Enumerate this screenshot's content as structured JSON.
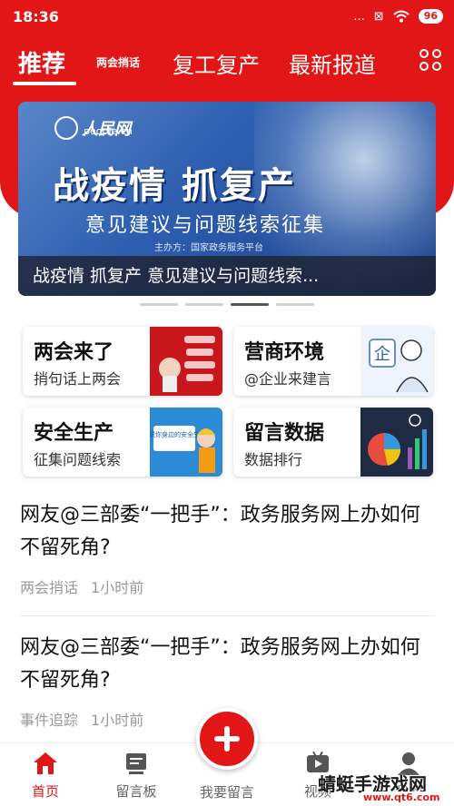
{
  "status": {
    "time": "18:36",
    "signal": "...",
    "battery": "96"
  },
  "tabs": [
    {
      "label": "推荐",
      "active": true
    },
    {
      "label": "两会捎话",
      "active": false
    },
    {
      "label": "复工复产",
      "active": false
    },
    {
      "label": "最新报道",
      "active": false
    }
  ],
  "banner": {
    "logo_text": "人民网",
    "logo_sub": "people.cn",
    "headline": "战疫情 抓复产",
    "sub": "意见建议与问题线索征集",
    "host": "主办方：国家政务服务平台",
    "caption": "战疫情 抓复产 意见建议与问题线索...",
    "page_count": 4,
    "active_page": 3
  },
  "cards": [
    {
      "title": "两会来了",
      "desc": "捎句话上两会",
      "icon": "two-sessions-thumb"
    },
    {
      "title": "营商环境",
      "desc": "@企业来建言",
      "icon": "business-thumb"
    },
    {
      "title": "安全生产",
      "desc": "征集问题线索",
      "icon": "safety-thumb",
      "thumb_text": "说说你身边的安全生产"
    },
    {
      "title": "留言数据",
      "desc": "数据排行",
      "icon": "data-chart-thumb"
    }
  ],
  "news": [
    {
      "title": "网友@三部委“一把手”：政务服务网上办如何不留死角?",
      "category": "两会捎话",
      "time": "1小时前"
    },
    {
      "title": "网友@三部委“一把手”：政务服务网上办如何不留死角?",
      "category": "事件追踪",
      "time": "1小时前"
    }
  ],
  "nav": {
    "home": "首页",
    "board": "留言板",
    "post": "我要留言",
    "video": "视频",
    "mine": "我的"
  },
  "watermark": {
    "text": "蜻蜓手游戏网",
    "url": "www.qt6.com"
  },
  "colors": {
    "accent": "#e31617"
  }
}
